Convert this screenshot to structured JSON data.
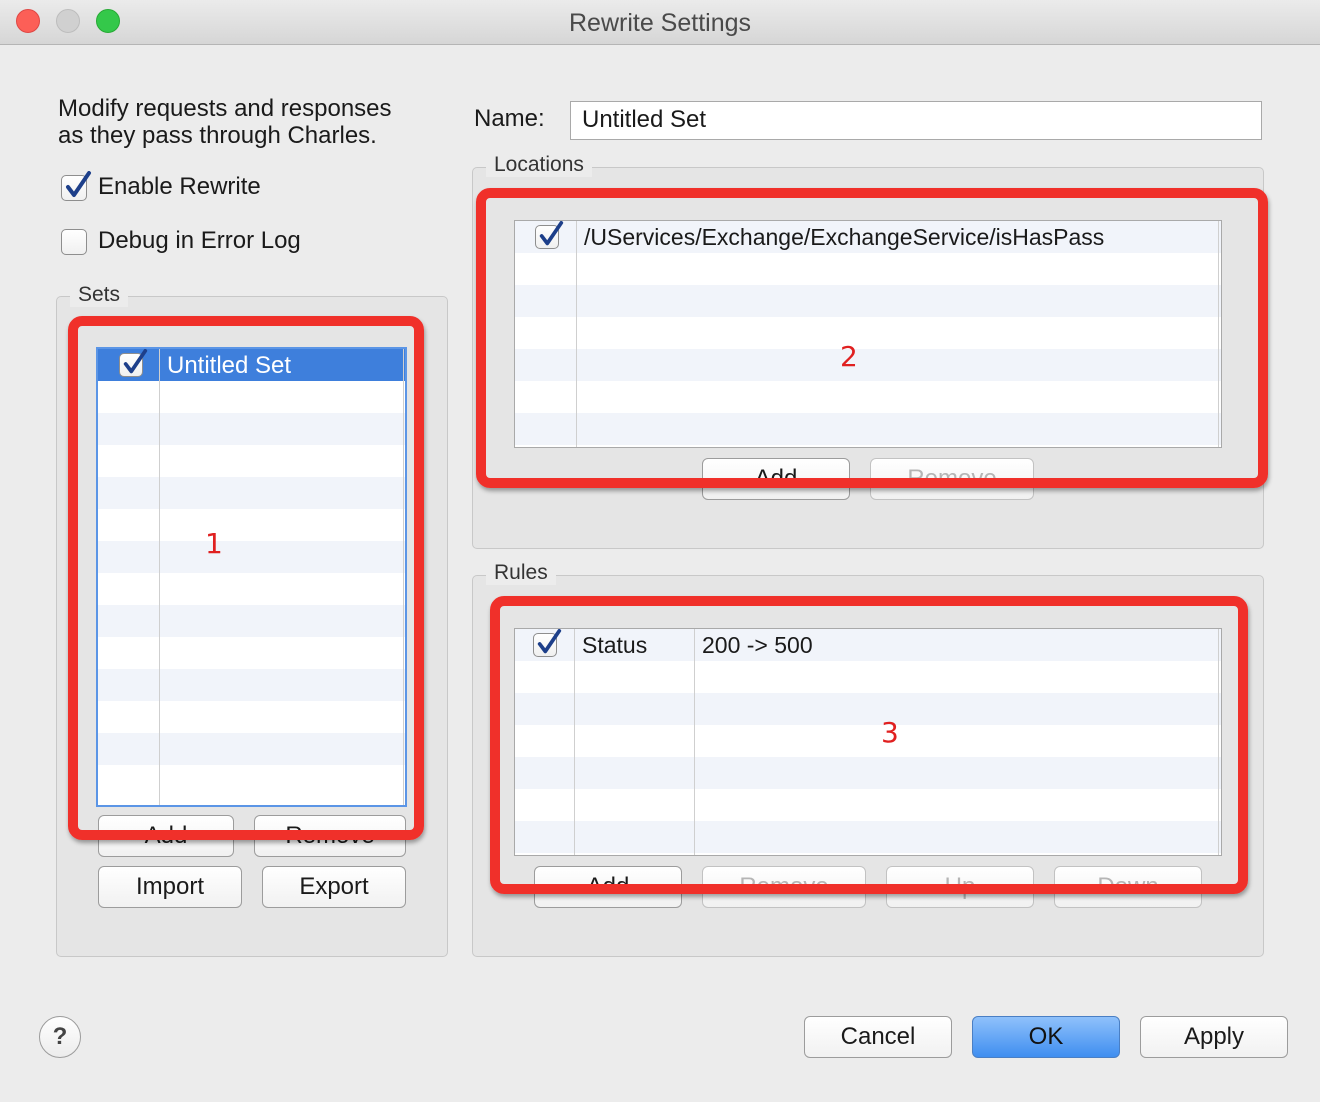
{
  "window": {
    "title": "Rewrite Settings"
  },
  "intro": {
    "line1": "Modify requests and responses",
    "line2": "as they pass through Charles."
  },
  "options": {
    "enable_rewrite": {
      "label": "Enable Rewrite",
      "checked": true
    },
    "debug_log": {
      "label": "Debug in Error Log",
      "checked": false
    }
  },
  "sets": {
    "legend": "Sets",
    "items": [
      {
        "name": "Untitled Set",
        "checked": true,
        "selected": true
      }
    ],
    "buttons": {
      "add": "Add",
      "remove": "Remove",
      "import": "Import",
      "export": "Export"
    }
  },
  "name_field": {
    "label": "Name:",
    "value": "Untitled Set"
  },
  "locations": {
    "legend": "Locations",
    "items": [
      {
        "path": "/UServices/Exchange/ExchangeService/isHasPass",
        "checked": true
      }
    ],
    "buttons": {
      "add": "Add",
      "remove": "Remove"
    }
  },
  "rules": {
    "legend": "Rules",
    "items": [
      {
        "type": "Status",
        "description": "200 -> 500",
        "checked": true
      }
    ],
    "buttons": {
      "add": "Add",
      "remove": "Remove",
      "up": "Up",
      "down": "Down"
    }
  },
  "footer": {
    "help": "?",
    "cancel": "Cancel",
    "ok": "OK",
    "apply": "Apply"
  },
  "annotations": {
    "box1": "1",
    "box2": "2",
    "box3": "3",
    "color": "#f0302a"
  }
}
